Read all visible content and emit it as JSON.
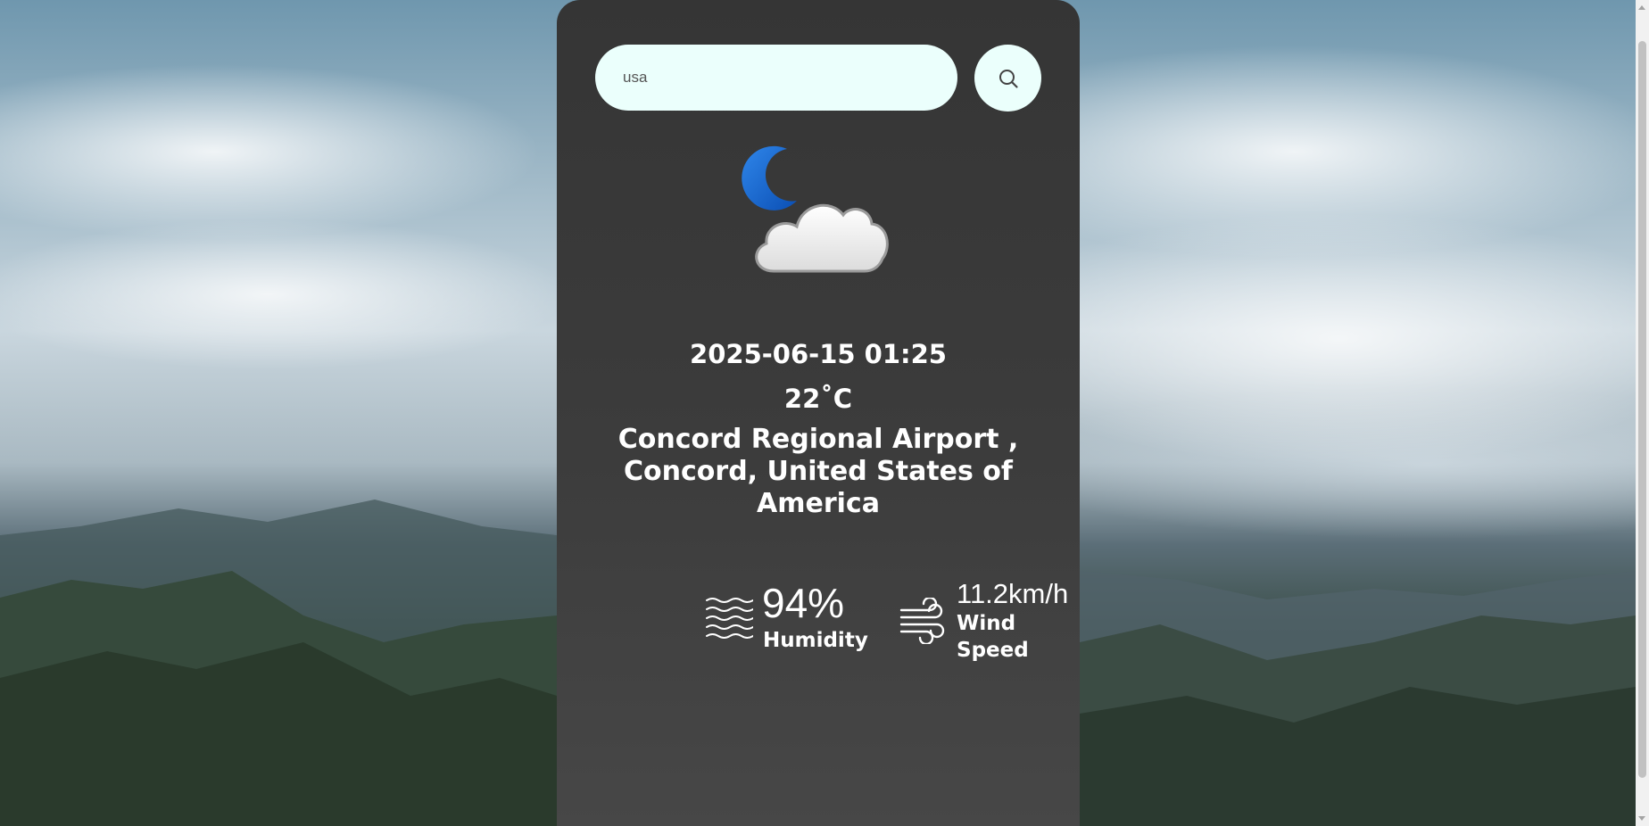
{
  "search": {
    "value": "usa",
    "icon": "search-icon"
  },
  "weather": {
    "condition_icon": "cloud-moon-icon",
    "datetime": "2025-06-15 01:25",
    "temperature": "22˚C",
    "location": "Concord Regional Airport , Concord, United States of America"
  },
  "details": {
    "humidity": {
      "value": "94%",
      "label": "Humidity",
      "icon": "humidity-icon"
    },
    "wind": {
      "value": "11.2km/h",
      "label": "Wind Speed",
      "icon": "wind-icon"
    }
  },
  "colors": {
    "card_background": "#3a3a3a",
    "search_background": "#ebfffc",
    "moon": "#1e6fd9",
    "text": "#ffffff"
  }
}
